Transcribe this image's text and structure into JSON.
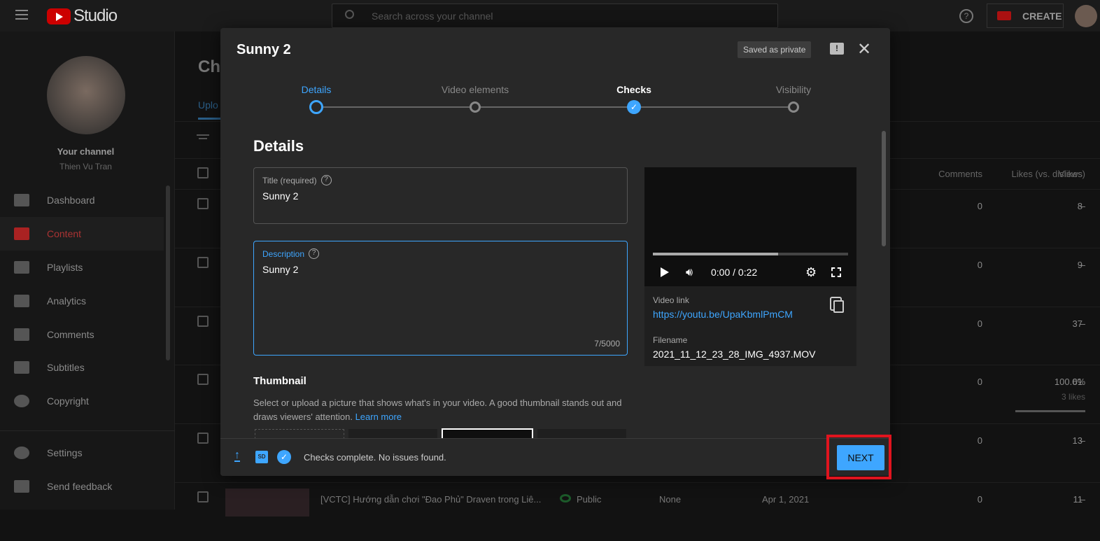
{
  "topbar": {
    "logo": "Studio",
    "search_placeholder": "Search across your channel",
    "create": "CREATE"
  },
  "sidebar": {
    "channel_label": "Your channel",
    "channel_name": "Thien Vu Tran",
    "items": [
      {
        "label": "Dashboard"
      },
      {
        "label": "Content"
      },
      {
        "label": "Playlists"
      },
      {
        "label": "Analytics"
      },
      {
        "label": "Comments"
      },
      {
        "label": "Subtitles"
      },
      {
        "label": "Copyright"
      },
      {
        "label": "Settings"
      },
      {
        "label": "Send feedback"
      }
    ]
  },
  "main": {
    "title": "Cha",
    "tab": "Uplo",
    "columns": {
      "views": "Views",
      "comments": "Comments",
      "likes": "Likes (vs. dislikes)"
    },
    "rows": [
      {
        "views": "8",
        "comments": "0",
        "likes": "–"
      },
      {
        "views": "9",
        "comments": "0",
        "likes": "–"
      },
      {
        "views": "37",
        "comments": "0",
        "likes": "–"
      },
      {
        "views": "61",
        "comments": "0",
        "likes": "100.0%",
        "likes_sub": "3 likes"
      },
      {
        "views": "13",
        "comments": "0",
        "likes": "–"
      },
      {
        "views": "11",
        "comments": "0",
        "likes": "–",
        "title": "[VCTC] Hướng dẫn chơi \"Đao Phủ\" Draven trong Liê...",
        "visibility": "Public",
        "restrictions": "None",
        "date": "Apr 1, 2021"
      }
    ]
  },
  "modal": {
    "title": "Sunny 2",
    "saved_badge": "Saved as private",
    "steps": [
      {
        "label": "Details",
        "state": "current"
      },
      {
        "label": "Video elements",
        "state": "pending"
      },
      {
        "label": "Checks",
        "state": "done"
      },
      {
        "label": "Visibility",
        "state": "pending"
      }
    ],
    "section_title": "Details",
    "title_field": {
      "label": "Title (required)",
      "value": "Sunny 2"
    },
    "description_field": {
      "label": "Description",
      "value": "Sunny 2",
      "counter": "7/5000"
    },
    "player": {
      "time": "0:00 / 0:22",
      "progress": 0.64
    },
    "video_link_label": "Video link",
    "video_link": "https://youtu.be/UpaKbmlPmCM",
    "filename_label": "Filename",
    "filename": "2021_11_12_23_28_IMG_4937.MOV",
    "thumbnail_title": "Thumbnail",
    "thumbnail_desc": "Select or upload a picture that shows what's in your video. A good thumbnail stands out and draws viewers' attention.",
    "learn_more": "Learn more",
    "footer_status": "Checks complete. No issues found.",
    "sd_badge": "SD",
    "next": "NEXT"
  },
  "colors": {
    "accent": "#3ea6ff",
    "highlight": "#e0141e",
    "brand_red": "#ff0000"
  }
}
